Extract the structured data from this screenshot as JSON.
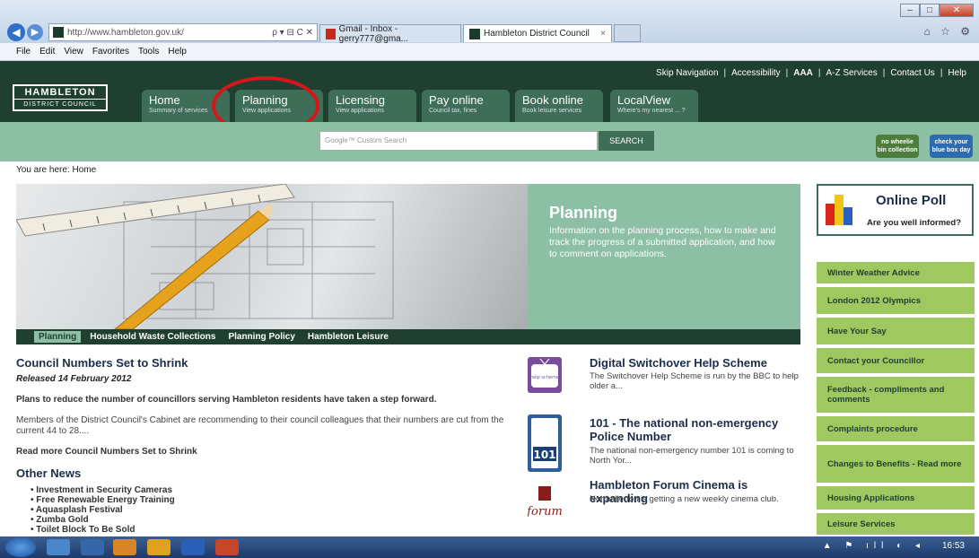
{
  "browser": {
    "url": "http://www.hambleton.gov.uk/",
    "address_tools": "ρ ▾ ⊟ C ✕",
    "tabs": [
      {
        "label": "Gmail - Inbox - gerry777@gma..."
      },
      {
        "label": "Hambleton District Council",
        "close": "×"
      }
    ],
    "menu": [
      "File",
      "Edit",
      "View",
      "Favorites",
      "Tools",
      "Help"
    ],
    "window_controls": [
      "–",
      "□",
      "✕"
    ],
    "right_icons": "⌂ ☆ ⚙"
  },
  "site": {
    "utility_links": [
      "Skip Navigation",
      "Accessibility",
      "AAA",
      "A-Z Services",
      "Contact Us",
      "Help"
    ],
    "logo": {
      "line1": "HAMBLETON",
      "line2": "DISTRICT COUNCIL"
    },
    "nav": [
      {
        "title": "Home",
        "sub": "Summary of services"
      },
      {
        "title": "Planning",
        "sub": "View applications"
      },
      {
        "title": "Licensing",
        "sub": "View applications"
      },
      {
        "title": "Pay online",
        "sub": "Council tax, fines"
      },
      {
        "title": "Book online",
        "sub": "Book leisure services"
      },
      {
        "title": "LocalView",
        "sub": "Where's my nearest ... ?"
      }
    ],
    "search": {
      "placeholder": "Google™ Custom Search",
      "button": "SEARCH"
    },
    "badges": {
      "bin": "no wheelie bin collection",
      "blue": "check your blue box day"
    }
  },
  "breadcrumb": {
    "prefix": "You are here:",
    "current": "Home"
  },
  "hero": {
    "title": "Planning",
    "text": "Information on the planning process, how to make and track the progress of a submitted application, and how to comment on applications.",
    "tabs": [
      "Planning",
      "Household Waste Collections",
      "Planning Policy",
      "Hambleton Leisure"
    ]
  },
  "news": {
    "title": "Council Numbers Set to Shrink",
    "date": "Released 14 February 2012",
    "lead": "Plans to reduce the number of councillors serving Hambleton residents have taken a step forward.",
    "body": "Members of the District Council's Cabinet are recommending to their council colleagues that their numbers are cut from the current 44 to 28....",
    "more": "Read more Council Numbers Set to Shrink"
  },
  "other_news": {
    "title": "Other News",
    "items": [
      "Investment in Security Cameras",
      "Free Renewable Energy Training",
      "Aquasplash Festival",
      "Zumba Gold",
      "Toilet Block To Be Sold"
    ]
  },
  "features": [
    {
      "title": "Digital Switchover Help Scheme",
      "text": "The Switchover Help Scheme is run by the BBC to help older a..."
    },
    {
      "title": "101 - The national non-emergency Police Number",
      "text": "The national non-emergency number 101 is coming to North Yor..."
    },
    {
      "title": "Hambleton Forum Cinema is expanding",
      "text": "Northallerton is getting a new weekly cinema club.",
      "logo_text": "forum"
    }
  ],
  "poll": {
    "title": "Online Poll",
    "question": "Are you well informed?"
  },
  "quick_links": [
    "Winter Weather Advice",
    "London 2012 Olympics",
    "Have Your Say",
    "Contact your Councillor",
    "Feedback - compliments and comments",
    "Complaints procedure",
    "Changes to Benefits - Read more",
    "Housing Applications",
    "Leisure Services"
  ],
  "taskbar": {
    "time": "16:53",
    "tray": "▲ ⚑ ıll ◐ ◂"
  }
}
